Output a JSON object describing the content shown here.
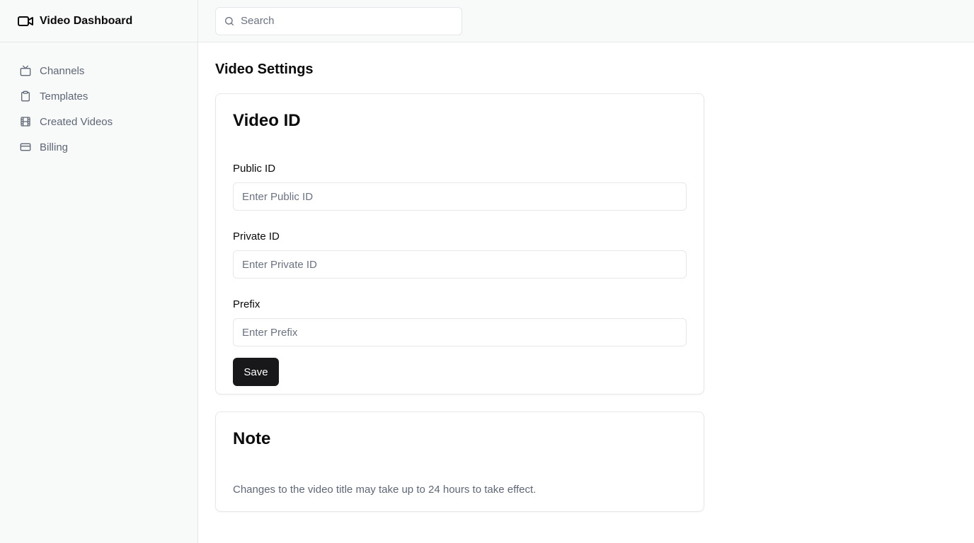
{
  "app": {
    "title": "Video Dashboard",
    "icon": "video-camera-icon"
  },
  "sidebar": {
    "items": [
      {
        "label": "Channels",
        "icon": "tv-icon"
      },
      {
        "label": "Templates",
        "icon": "clipboard-icon"
      },
      {
        "label": "Created Videos",
        "icon": "film-icon"
      },
      {
        "label": "Billing",
        "icon": "credit-card-icon"
      }
    ]
  },
  "header": {
    "search": {
      "placeholder": "Search",
      "value": "",
      "icon": "search-icon"
    }
  },
  "page": {
    "title": "Video Settings"
  },
  "video_id_card": {
    "title": "Video ID",
    "fields": [
      {
        "label": "Public ID",
        "placeholder": "Enter Public ID",
        "value": ""
      },
      {
        "label": "Private ID",
        "placeholder": "Enter Private ID",
        "value": ""
      },
      {
        "label": "Prefix",
        "placeholder": "Enter Prefix",
        "value": ""
      }
    ],
    "save_label": "Save"
  },
  "note_card": {
    "title": "Note",
    "text": "Changes to the video title may take up to 24 hours to take effect."
  },
  "colors": {
    "sidebar_bg": "#f8f9f9",
    "border": "#e5e7eb",
    "primary_button": "#18181b",
    "muted_text": "#5f6775"
  }
}
